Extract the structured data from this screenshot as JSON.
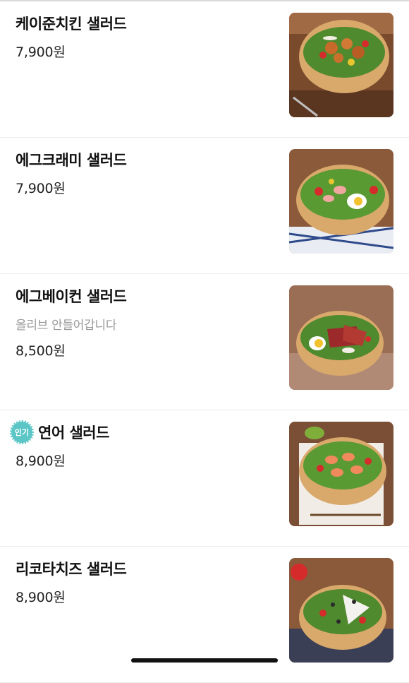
{
  "menu": {
    "items": [
      {
        "name": "케이준치킨 샐러드",
        "price": "7,900원",
        "desc": "",
        "badge": "",
        "image": "cajun-chicken-salad-photo"
      },
      {
        "name": "에그크래미 샐러드",
        "price": "7,900원",
        "desc": "",
        "badge": "",
        "image": "egg-crab-salad-photo"
      },
      {
        "name": "에그베이컨 샐러드",
        "price": "8,500원",
        "desc": "올리브 안들어갑니다",
        "badge": "",
        "image": "egg-bacon-salad-photo"
      },
      {
        "name": "연어 샐러드",
        "price": "8,900원",
        "desc": "",
        "badge": "인기",
        "image": "salmon-salad-photo"
      },
      {
        "name": "리코타치즈 샐러드",
        "price": "8,900원",
        "desc": "",
        "badge": "",
        "image": "ricotta-cheese-salad-photo"
      }
    ]
  },
  "colors": {
    "badge": "#5cc6c6",
    "divider": "#ebebeb",
    "desc_text": "#9a9a9a"
  }
}
